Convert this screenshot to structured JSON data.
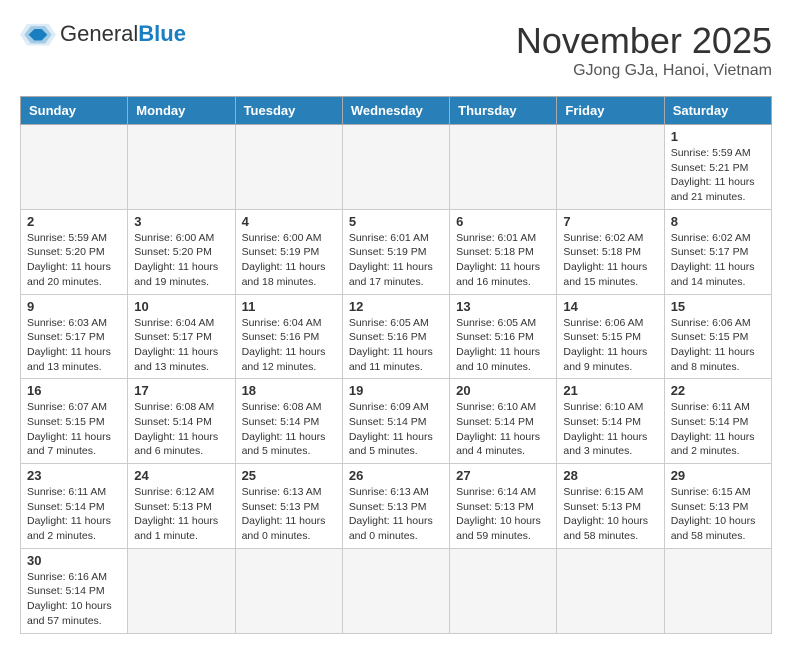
{
  "header": {
    "logo_general": "General",
    "logo_blue": "Blue",
    "month_title": "November 2025",
    "location": "GJong GJa, Hanoi, Vietnam"
  },
  "weekdays": [
    "Sunday",
    "Monday",
    "Tuesday",
    "Wednesday",
    "Thursday",
    "Friday",
    "Saturday"
  ],
  "weeks": [
    [
      {
        "day": "",
        "info": ""
      },
      {
        "day": "",
        "info": ""
      },
      {
        "day": "",
        "info": ""
      },
      {
        "day": "",
        "info": ""
      },
      {
        "day": "",
        "info": ""
      },
      {
        "day": "",
        "info": ""
      },
      {
        "day": "1",
        "info": "Sunrise: 5:59 AM\nSunset: 5:21 PM\nDaylight: 11 hours and 21 minutes."
      }
    ],
    [
      {
        "day": "2",
        "info": "Sunrise: 5:59 AM\nSunset: 5:20 PM\nDaylight: 11 hours and 20 minutes."
      },
      {
        "day": "3",
        "info": "Sunrise: 6:00 AM\nSunset: 5:20 PM\nDaylight: 11 hours and 19 minutes."
      },
      {
        "day": "4",
        "info": "Sunrise: 6:00 AM\nSunset: 5:19 PM\nDaylight: 11 hours and 18 minutes."
      },
      {
        "day": "5",
        "info": "Sunrise: 6:01 AM\nSunset: 5:19 PM\nDaylight: 11 hours and 17 minutes."
      },
      {
        "day": "6",
        "info": "Sunrise: 6:01 AM\nSunset: 5:18 PM\nDaylight: 11 hours and 16 minutes."
      },
      {
        "day": "7",
        "info": "Sunrise: 6:02 AM\nSunset: 5:18 PM\nDaylight: 11 hours and 15 minutes."
      },
      {
        "day": "8",
        "info": "Sunrise: 6:02 AM\nSunset: 5:17 PM\nDaylight: 11 hours and 14 minutes."
      }
    ],
    [
      {
        "day": "9",
        "info": "Sunrise: 6:03 AM\nSunset: 5:17 PM\nDaylight: 11 hours and 13 minutes."
      },
      {
        "day": "10",
        "info": "Sunrise: 6:04 AM\nSunset: 5:17 PM\nDaylight: 11 hours and 13 minutes."
      },
      {
        "day": "11",
        "info": "Sunrise: 6:04 AM\nSunset: 5:16 PM\nDaylight: 11 hours and 12 minutes."
      },
      {
        "day": "12",
        "info": "Sunrise: 6:05 AM\nSunset: 5:16 PM\nDaylight: 11 hours and 11 minutes."
      },
      {
        "day": "13",
        "info": "Sunrise: 6:05 AM\nSunset: 5:16 PM\nDaylight: 11 hours and 10 minutes."
      },
      {
        "day": "14",
        "info": "Sunrise: 6:06 AM\nSunset: 5:15 PM\nDaylight: 11 hours and 9 minutes."
      },
      {
        "day": "15",
        "info": "Sunrise: 6:06 AM\nSunset: 5:15 PM\nDaylight: 11 hours and 8 minutes."
      }
    ],
    [
      {
        "day": "16",
        "info": "Sunrise: 6:07 AM\nSunset: 5:15 PM\nDaylight: 11 hours and 7 minutes."
      },
      {
        "day": "17",
        "info": "Sunrise: 6:08 AM\nSunset: 5:14 PM\nDaylight: 11 hours and 6 minutes."
      },
      {
        "day": "18",
        "info": "Sunrise: 6:08 AM\nSunset: 5:14 PM\nDaylight: 11 hours and 5 minutes."
      },
      {
        "day": "19",
        "info": "Sunrise: 6:09 AM\nSunset: 5:14 PM\nDaylight: 11 hours and 5 minutes."
      },
      {
        "day": "20",
        "info": "Sunrise: 6:10 AM\nSunset: 5:14 PM\nDaylight: 11 hours and 4 minutes."
      },
      {
        "day": "21",
        "info": "Sunrise: 6:10 AM\nSunset: 5:14 PM\nDaylight: 11 hours and 3 minutes."
      },
      {
        "day": "22",
        "info": "Sunrise: 6:11 AM\nSunset: 5:14 PM\nDaylight: 11 hours and 2 minutes."
      }
    ],
    [
      {
        "day": "23",
        "info": "Sunrise: 6:11 AM\nSunset: 5:14 PM\nDaylight: 11 hours and 2 minutes."
      },
      {
        "day": "24",
        "info": "Sunrise: 6:12 AM\nSunset: 5:13 PM\nDaylight: 11 hours and 1 minute."
      },
      {
        "day": "25",
        "info": "Sunrise: 6:13 AM\nSunset: 5:13 PM\nDaylight: 11 hours and 0 minutes."
      },
      {
        "day": "26",
        "info": "Sunrise: 6:13 AM\nSunset: 5:13 PM\nDaylight: 11 hours and 0 minutes."
      },
      {
        "day": "27",
        "info": "Sunrise: 6:14 AM\nSunset: 5:13 PM\nDaylight: 10 hours and 59 minutes."
      },
      {
        "day": "28",
        "info": "Sunrise: 6:15 AM\nSunset: 5:13 PM\nDaylight: 10 hours and 58 minutes."
      },
      {
        "day": "29",
        "info": "Sunrise: 6:15 AM\nSunset: 5:13 PM\nDaylight: 10 hours and 58 minutes."
      }
    ],
    [
      {
        "day": "30",
        "info": "Sunrise: 6:16 AM\nSunset: 5:14 PM\nDaylight: 10 hours and 57 minutes."
      },
      {
        "day": "",
        "info": ""
      },
      {
        "day": "",
        "info": ""
      },
      {
        "day": "",
        "info": ""
      },
      {
        "day": "",
        "info": ""
      },
      {
        "day": "",
        "info": ""
      },
      {
        "day": "",
        "info": ""
      }
    ]
  ]
}
